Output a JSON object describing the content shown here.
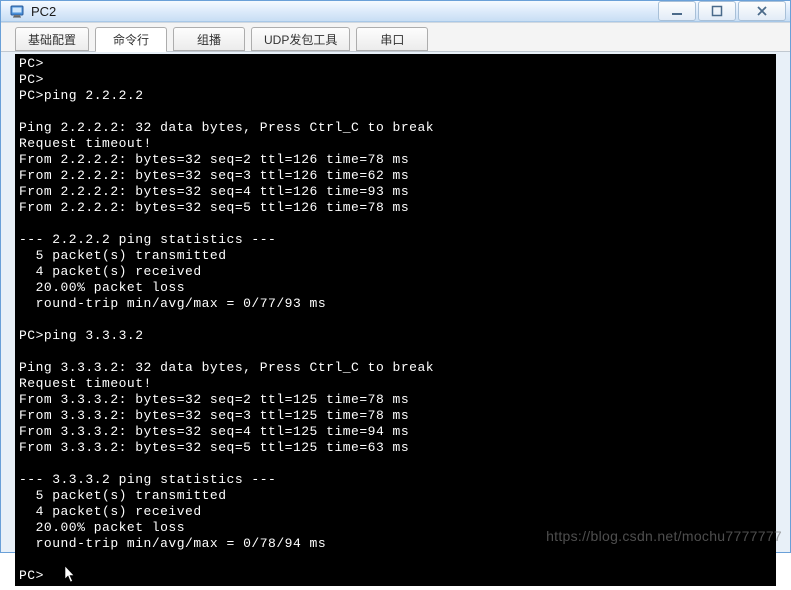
{
  "window": {
    "title": "PC2"
  },
  "tabs": [
    {
      "label": "基础配置",
      "active": false
    },
    {
      "label": "命令行",
      "active": true
    },
    {
      "label": "组播",
      "active": false
    },
    {
      "label": "UDP发包工具",
      "active": false
    },
    {
      "label": "串口",
      "active": false
    }
  ],
  "terminal": {
    "lines": [
      "PC>",
      "PC>",
      "PC>ping 2.2.2.2",
      "",
      "Ping 2.2.2.2: 32 data bytes, Press Ctrl_C to break",
      "Request timeout!",
      "From 2.2.2.2: bytes=32 seq=2 ttl=126 time=78 ms",
      "From 2.2.2.2: bytes=32 seq=3 ttl=126 time=62 ms",
      "From 2.2.2.2: bytes=32 seq=4 ttl=126 time=93 ms",
      "From 2.2.2.2: bytes=32 seq=5 ttl=126 time=78 ms",
      "",
      "--- 2.2.2.2 ping statistics ---",
      "  5 packet(s) transmitted",
      "  4 packet(s) received",
      "  20.00% packet loss",
      "  round-trip min/avg/max = 0/77/93 ms",
      "",
      "PC>ping 3.3.3.2",
      "",
      "Ping 3.3.3.2: 32 data bytes, Press Ctrl_C to break",
      "Request timeout!",
      "From 3.3.3.2: bytes=32 seq=2 ttl=125 time=78 ms",
      "From 3.3.3.2: bytes=32 seq=3 ttl=125 time=78 ms",
      "From 3.3.3.2: bytes=32 seq=4 ttl=125 time=94 ms",
      "From 3.3.3.2: bytes=32 seq=5 ttl=125 time=63 ms",
      "",
      "--- 3.3.3.2 ping statistics ---",
      "  5 packet(s) transmitted",
      "  4 packet(s) received",
      "  20.00% packet loss",
      "  round-trip min/avg/max = 0/78/94 ms",
      "",
      "PC>"
    ]
  },
  "watermark": "https://blog.csdn.net/mochu7777777"
}
